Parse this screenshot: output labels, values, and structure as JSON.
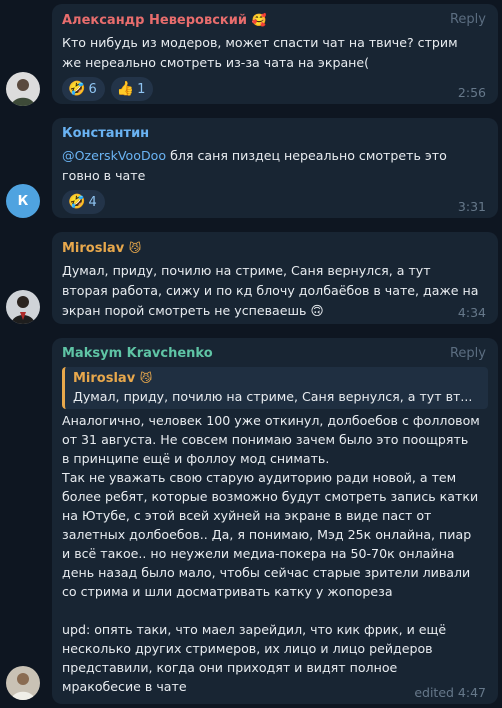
{
  "messages": [
    {
      "author": "Александр Неверовский",
      "author_emoji": "🥰",
      "author_color": "#e86d6d",
      "text": "Кто нибудь из модеров, может спасти чат на твиче? стрим\nже нереально смотреть из-за чата на экране(",
      "reply_label": "Reply",
      "reactions": [
        {
          "emoji": "🤣",
          "count": "6"
        },
        {
          "emoji": "👍",
          "count": "1"
        }
      ],
      "time": "2:56"
    },
    {
      "author": "Константин",
      "author_color": "#6ab3f3",
      "avatar_letter": "К",
      "mention": "@OzerskVooDoo",
      "text": " бля саня пиздец нереально смотреть это\nговно в чате",
      "reactions": [
        {
          "emoji": "🤣",
          "count": "4"
        }
      ],
      "time": "3:31"
    },
    {
      "author": "Miroslav",
      "author_emoji": "😼",
      "author_color": "#e8a84c",
      "text": "Думал, приду, почилю на стриме, Саня вернулся, а тут\nвторая работа, сижу и по кд блочу долбаёбов в чате, даже на\nэкран порой смотреть не успеваешь 🙃",
      "time": "4:34"
    },
    {
      "author": "Maksym Kravchenko",
      "author_color": "#5fc4a5",
      "reply_label": "Reply",
      "quote": {
        "author": "Miroslav",
        "author_emoji": "😼",
        "text": "Думал, приду, почилю на стриме, Саня вернулся, а тут вт..."
      },
      "text": "Аналогично, человек 100 уже откинул, долбоебов с фолловом\nот 31 августа. Не совсем понимаю зачем было это поощрять\nв принципе ещё и фоллоу мод снимать.\nТак не уважать свою старую аудиторию ради новой, а тем\nболее ребят, которые возможно будут смотреть запись катки\nна Ютубе, с этой всей хуйней на экране в виде паст от\nзалетных долбоебов.. Да, я понимаю, Мэд 25к онлайна, пиар\nи всё такое.. но неужели медиа-покера на 50-70к онлайна\nдень назад было мало, чтобы сейчас старые зрители ливали\nсо стрима и шли досматривать катку у жопореза\n\nupd: опять таки, что маел зарейдил, что кик фрик, и ещё\nнесколько других стримеров, их лицо и лицо рейдеров\nпредставили, когда они приходят и видят полное\nмракобесие в чате",
      "time": "edited 4:47"
    }
  ]
}
